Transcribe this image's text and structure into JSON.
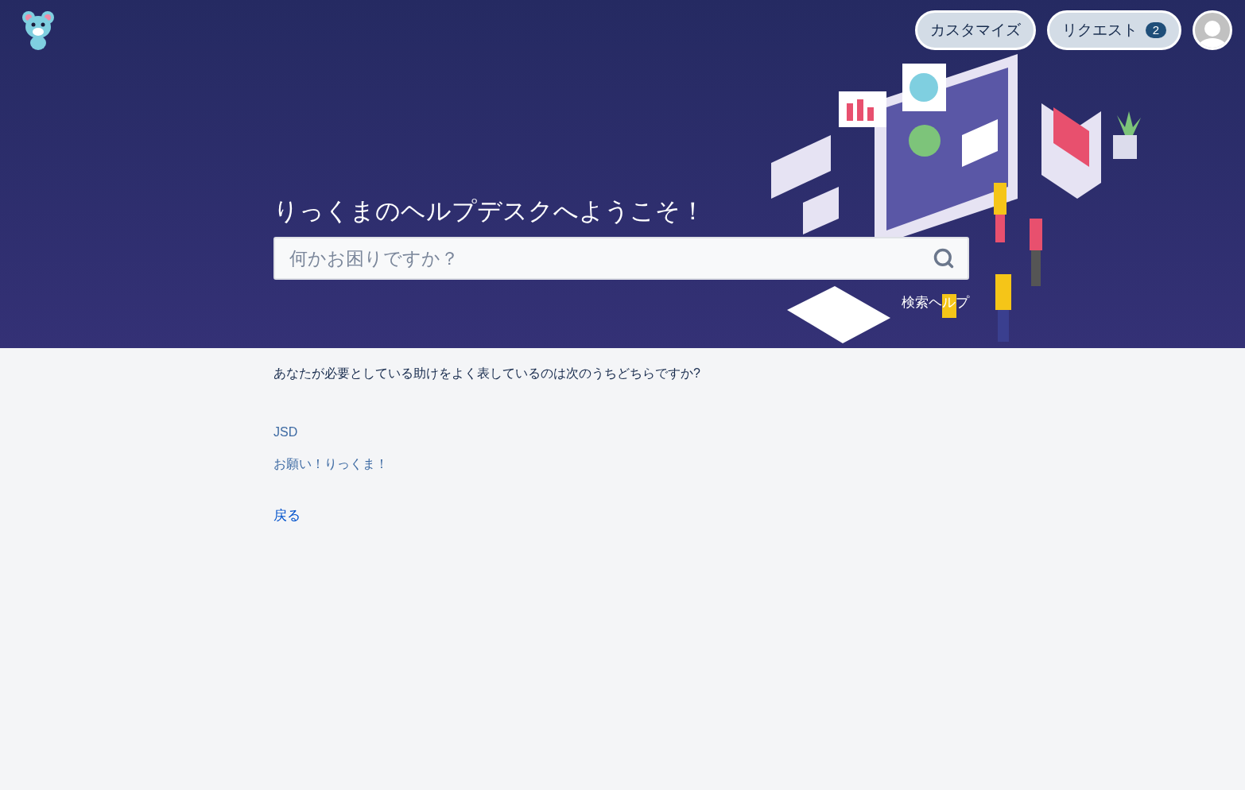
{
  "header": {
    "buttons": [
      {
        "label": "カスタマイズ"
      },
      {
        "label": "リクエスト",
        "count": "2"
      }
    ]
  },
  "hero": {
    "title": "りっくまのヘルプデスクへようこそ！",
    "search": {
      "placeholder": "何かお困りですか？"
    },
    "search_help": "検索ヘルプ"
  },
  "content": {
    "question": "あなたが必要としている助けをよく表しているのは次のうちどちらですか?",
    "options": [
      {
        "label": "JSD"
      },
      {
        "label": "お願い！りっくま！"
      }
    ],
    "back_link": "戻る"
  }
}
